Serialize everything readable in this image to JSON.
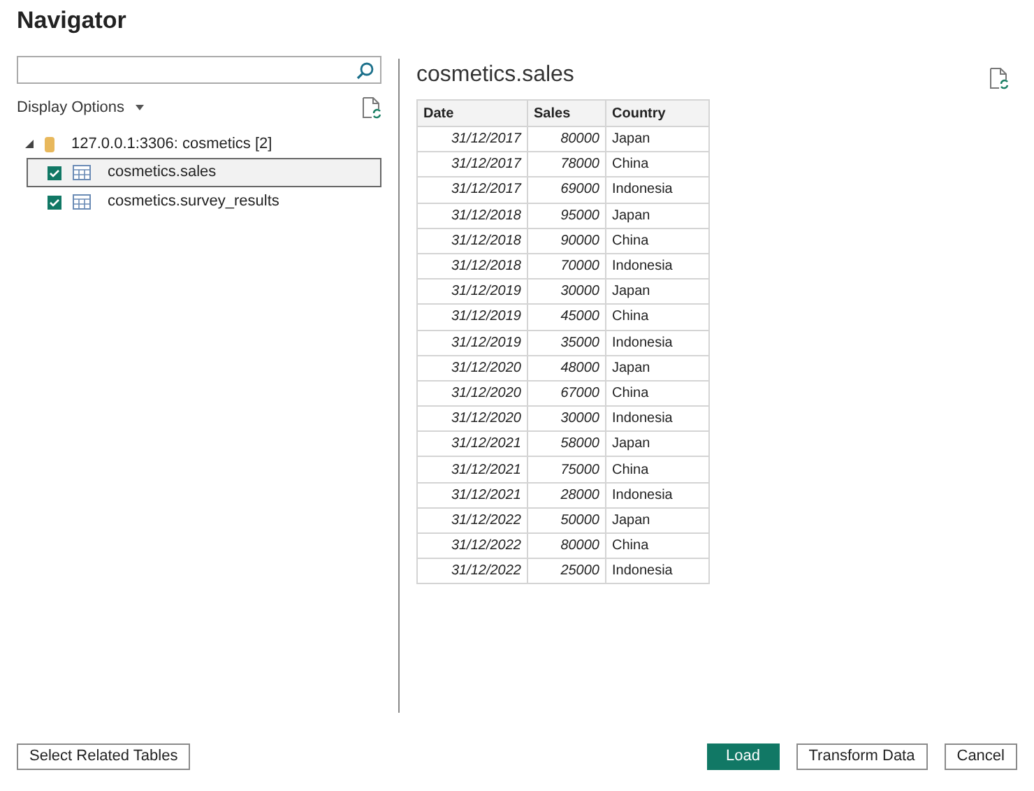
{
  "window": {
    "title": "Navigator"
  },
  "display_options": {
    "label": "Display Options"
  },
  "tree": [
    {
      "label": "127.0.0.1:3306: cosmetics [2]",
      "expanded": true,
      "children": [
        {
          "label": "cosmetics.sales",
          "checked": true,
          "selected": true
        },
        {
          "label": "cosmetics.survey_results",
          "checked": true,
          "selected": false
        }
      ]
    }
  ],
  "preview": {
    "title": "cosmetics.sales",
    "columns": [
      "Date",
      "Sales",
      "Country"
    ],
    "rows": [
      [
        "31/12/2017",
        "80000",
        "Japan"
      ],
      [
        "31/12/2017",
        "78000",
        "China"
      ],
      [
        "31/12/2017",
        "69000",
        "Indonesia"
      ],
      [
        "31/12/2018",
        "95000",
        "Japan"
      ],
      [
        "31/12/2018",
        "90000",
        "China"
      ],
      [
        "31/12/2018",
        "70000",
        "Indonesia"
      ],
      [
        "31/12/2019",
        "30000",
        "Japan"
      ],
      [
        "31/12/2019",
        "45000",
        "China"
      ],
      [
        "31/12/2019",
        "35000",
        "Indonesia"
      ],
      [
        "31/12/2020",
        "48000",
        "Japan"
      ],
      [
        "31/12/2020",
        "67000",
        "China"
      ],
      [
        "31/12/2020",
        "30000",
        "Indonesia"
      ],
      [
        "31/12/2021",
        "58000",
        "Japan"
      ],
      [
        "31/12/2021",
        "75000",
        "China"
      ],
      [
        "31/12/2021",
        "28000",
        "Indonesia"
      ],
      [
        "31/12/2022",
        "50000",
        "Japan"
      ],
      [
        "31/12/2022",
        "80000",
        "China"
      ],
      [
        "31/12/2022",
        "25000",
        "Indonesia"
      ]
    ]
  },
  "buttons": [
    {
      "label": "Select Related Tables",
      "kind": "secondary"
    },
    {
      "label": "Load",
      "kind": "primary"
    },
    {
      "label": "Transform Data",
      "kind": "secondary"
    },
    {
      "label": "Cancel",
      "kind": "secondary"
    }
  ]
}
